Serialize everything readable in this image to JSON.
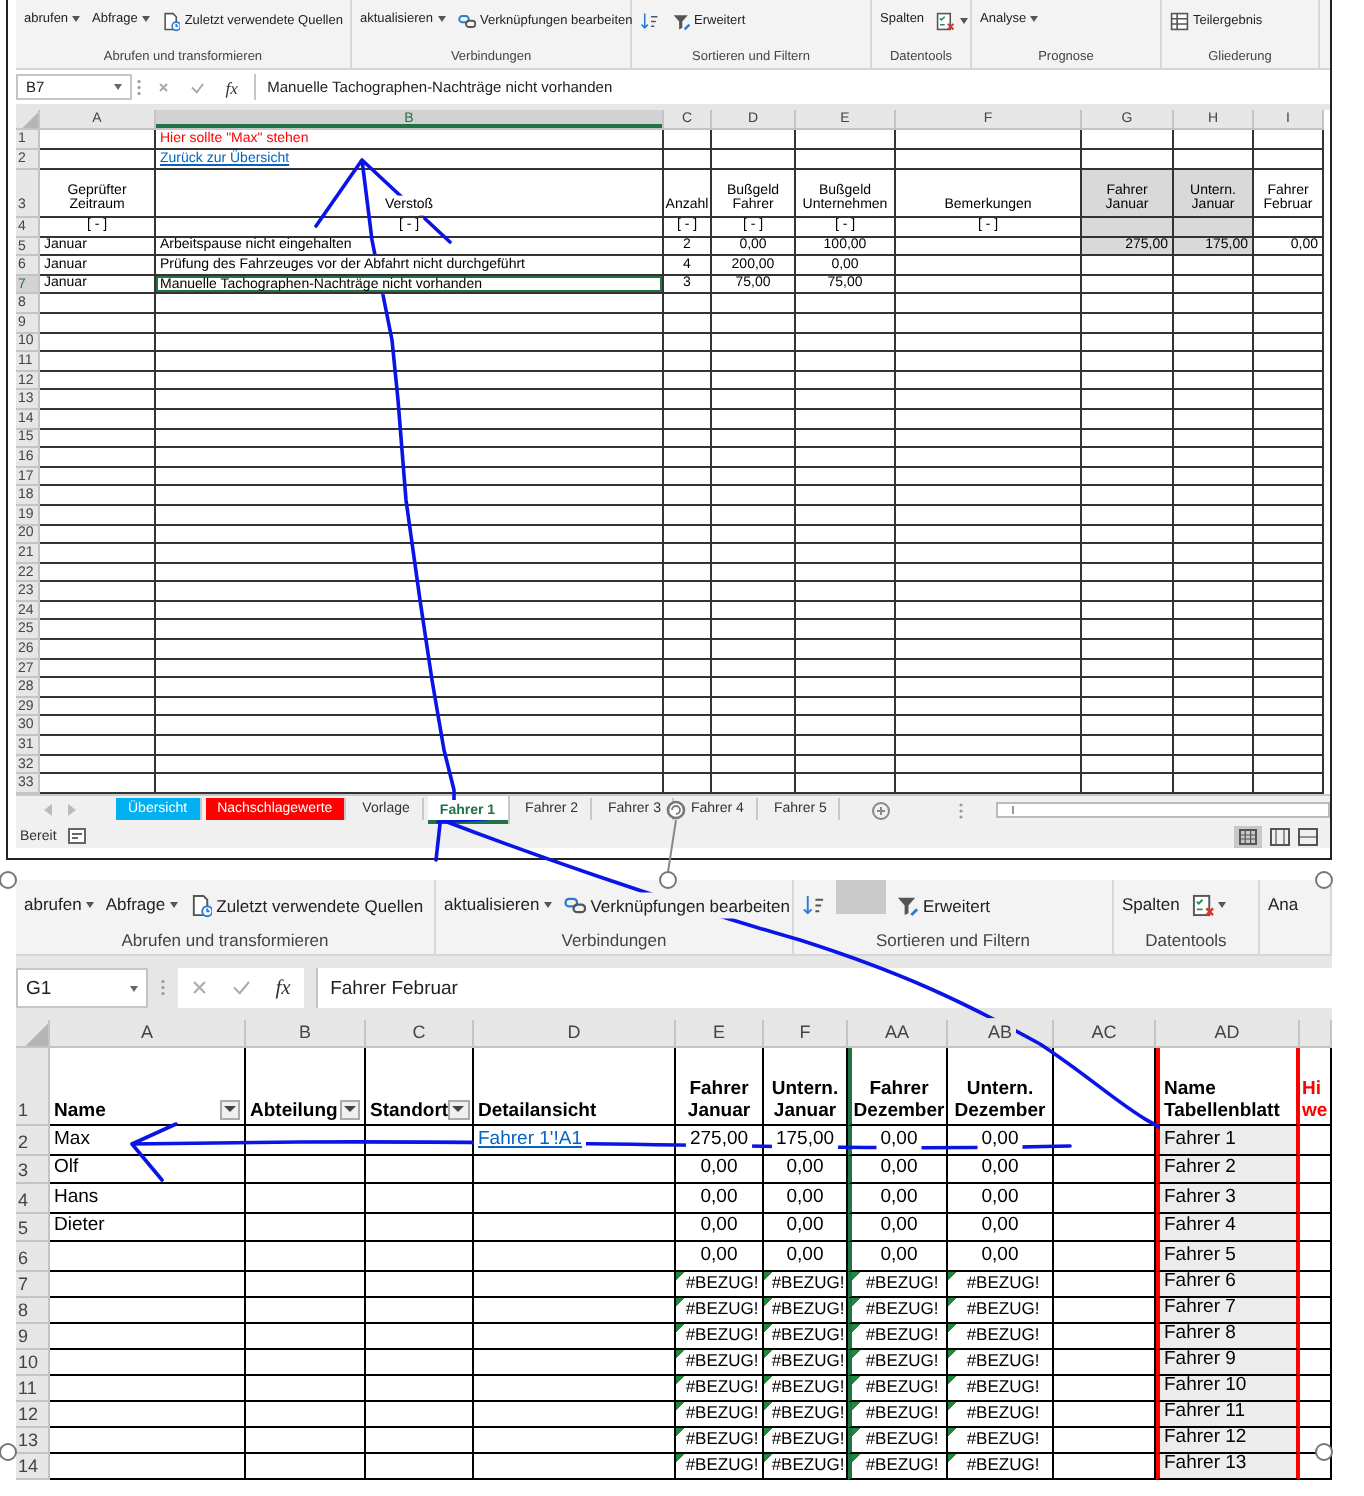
{
  "top_window": {
    "ribbon": {
      "groups": [
        {
          "label": "Abrufen und transformieren",
          "commands": [
            {
              "label": "abrufen",
              "dropdown": true,
              "pressed": false
            },
            {
              "label": "Abfrage",
              "dropdown": true,
              "pressed": false
            },
            {
              "label": "Zuletzt verwendete Quellen",
              "dropdown": false,
              "pressed": false
            }
          ]
        },
        {
          "label": "Verbindungen",
          "commands": [
            {
              "label": "aktualisieren",
              "dropdown": true,
              "pressed": false
            },
            {
              "label": "Verknüpfungen bearbeiten",
              "dropdown": false,
              "pressed": false
            }
          ]
        },
        {
          "label": "Sortieren und Filtern",
          "commands": [
            {
              "dropdown": false,
              "pressed": false
            },
            {
              "label": "Erweitert",
              "dropdown": false,
              "pressed": false
            }
          ]
        },
        {
          "label": "Datentools",
          "commands": [
            {
              "label": "Spalten",
              "dropdown": false,
              "pressed": false
            },
            {
              "dropdown": true,
              "pressed": false
            }
          ]
        },
        {
          "label": "Prognose",
          "commands": [
            {
              "label": "Analyse",
              "dropdown": true,
              "pressed": false
            }
          ]
        },
        {
          "label": "Gliederung",
          "commands": [
            {
              "label": "Teilergebnis",
              "dropdown": false,
              "pressed": false
            }
          ]
        }
      ]
    },
    "formula_bar": {
      "name_box": "B7",
      "function_label": "fx",
      "formula": "Manuelle Tachographen-Nachträge nicht vorhanden"
    },
    "grid": {
      "columns": [
        {
          "label": "A",
          "selected": false
        },
        {
          "label": "B",
          "selected": true
        },
        {
          "label": "C",
          "selected": false
        },
        {
          "label": "D",
          "selected": false
        },
        {
          "label": "E",
          "selected": false
        },
        {
          "label": "F",
          "selected": false
        },
        {
          "label": "G",
          "selected": false
        },
        {
          "label": "H",
          "selected": false
        },
        {
          "label": "I",
          "selected": false
        }
      ],
      "rows": [
        {
          "number": "1",
          "kind": "note",
          "selected": false,
          "cells": {
            "B": "Hier sollte \"Max\" stehen"
          }
        },
        {
          "number": "2",
          "kind": "link",
          "selected": false,
          "cells": {
            "B": "Zurück zur Übersicht"
          }
        },
        {
          "number": "3",
          "kind": "header",
          "selected": false,
          "shaded": true,
          "cells": {
            "A": "Geprüfter Zeitraum",
            "B": "Verstoß",
            "C": "Anzahl",
            "D": "Bußgeld Fahrer",
            "E": "Bußgeld Unternehmen",
            "F": "Bemerkungen",
            "G": "Fahrer Januar",
            "H": "Untern. Januar",
            "I": "Fahrer Februar"
          }
        },
        {
          "number": "4",
          "kind": "filter",
          "selected": false,
          "shaded": true,
          "cells": {
            "A": "[ - ]",
            "B": "[ - ]",
            "C": "[ - ]",
            "D": "[ - ]",
            "E": "[ - ]",
            "F": "[ - ]"
          }
        },
        {
          "number": "5",
          "kind": "data",
          "selected": false,
          "shaded": true,
          "cells": {
            "A": "Januar",
            "B": "Arbeitspause nicht eingehalten",
            "C": "2",
            "D": "0,00",
            "E": "100,00",
            "G": "275,00",
            "H": "175,00",
            "I": "0,00"
          }
        },
        {
          "number": "6",
          "kind": "data",
          "selected": false,
          "cells": {
            "A": "Januar",
            "B": "Prüfung des Fahrzeuges vor der Abfahrt nicht durchgeführt",
            "C": "4",
            "D": "200,00",
            "E": "0,00"
          }
        },
        {
          "number": "7",
          "kind": "data",
          "selected": true,
          "cells": {
            "A": "Januar",
            "B": "Manuelle Tachographen-Nachträge nicht vorhanden",
            "C": "3",
            "D": "75,00",
            "E": "75,00"
          }
        },
        {
          "number": "8",
          "kind": "data",
          "selected": false
        },
        {
          "number": "9",
          "kind": "data",
          "selected": false
        },
        {
          "number": "10",
          "kind": "data",
          "selected": false
        },
        {
          "number": "11",
          "kind": "data",
          "selected": false
        },
        {
          "number": "12",
          "kind": "data",
          "selected": false
        },
        {
          "number": "13",
          "kind": "data",
          "selected": false
        },
        {
          "number": "14",
          "kind": "data",
          "selected": false
        },
        {
          "number": "15",
          "kind": "data",
          "selected": false
        },
        {
          "number": "16",
          "kind": "data",
          "selected": false
        },
        {
          "number": "17",
          "kind": "data",
          "selected": false
        },
        {
          "number": "18",
          "kind": "data",
          "selected": false
        },
        {
          "number": "19",
          "kind": "data",
          "selected": false
        },
        {
          "number": "20",
          "kind": "data",
          "selected": false
        },
        {
          "number": "21",
          "kind": "data",
          "selected": false
        },
        {
          "number": "22",
          "kind": "data",
          "selected": false
        },
        {
          "number": "23",
          "kind": "data",
          "selected": false
        },
        {
          "number": "24",
          "kind": "data",
          "selected": false
        },
        {
          "number": "25",
          "kind": "data",
          "selected": false
        },
        {
          "number": "26",
          "kind": "data",
          "selected": false
        },
        {
          "number": "27",
          "kind": "data",
          "selected": false
        },
        {
          "number": "28",
          "kind": "data",
          "selected": false
        },
        {
          "number": "29",
          "kind": "data",
          "selected": false
        },
        {
          "number": "30",
          "kind": "data",
          "selected": false
        },
        {
          "number": "31",
          "kind": "data",
          "selected": false
        },
        {
          "number": "32",
          "kind": "data",
          "selected": false
        },
        {
          "number": "33",
          "kind": "data",
          "selected": false
        }
      ]
    },
    "sheet_tabs": [
      {
        "label": "Übersicht",
        "color": "#00b0f0",
        "selected": false
      },
      {
        "label": "Nachschlagewerte",
        "color": "#ff0000",
        "selected": false
      },
      {
        "label": "Vorlage",
        "selected": false
      },
      {
        "label": "Fahrer 1",
        "selected": true
      },
      {
        "label": "Fahrer 2",
        "selected": false
      },
      {
        "label": "Fahrer 3",
        "selected": false
      },
      {
        "label": "Fahrer 4",
        "selected": false
      },
      {
        "label": "Fahrer 5",
        "selected": false
      }
    ],
    "status_bar": {
      "text": "Bereit"
    }
  },
  "bottom_window": {
    "ribbon": {
      "groups": [
        {
          "label": "Abrufen und transformieren",
          "commands": [
            {
              "label": "abrufen",
              "dropdown": true,
              "pressed": false
            },
            {
              "label": "Abfrage",
              "dropdown": true,
              "pressed": false
            },
            {
              "label": "Zuletzt verwendete Quellen",
              "dropdown": false,
              "pressed": false
            }
          ]
        },
        {
          "label": "Verbindungen",
          "commands": [
            {
              "label": "aktualisieren",
              "dropdown": true,
              "pressed": false
            },
            {
              "label": "Verknüpfungen bearbeiten",
              "dropdown": false,
              "pressed": false
            }
          ]
        },
        {
          "label": "Sortieren und Filtern",
          "commands": [
            {
              "dropdown": false,
              "pressed": false
            },
            {
              "dropdown": false,
              "pressed": true
            },
            {
              "label": "Erweitert",
              "dropdown": false,
              "pressed": false
            }
          ]
        },
        {
          "label": "Datentools",
          "commands": [
            {
              "label": "Spalten",
              "dropdown": false,
              "pressed": false
            },
            {
              "dropdown": true,
              "pressed": false
            }
          ]
        },
        {
          "commands": [
            {
              "label": "Ana",
              "dropdown": false,
              "pressed": false
            }
          ]
        }
      ]
    },
    "formula_bar": {
      "name_box": "G1",
      "function_label": "fx",
      "formula": "Fahrer Februar"
    },
    "grid": {
      "columns": [
        {
          "label": "A",
          "kind": "plain",
          "selected": false
        },
        {
          "label": "B",
          "kind": "plain",
          "selected": false
        },
        {
          "label": "C",
          "kind": "plain",
          "selected": false
        },
        {
          "label": "D",
          "kind": "link",
          "selected": false
        },
        {
          "label": "E",
          "kind": "plain",
          "selected": false
        },
        {
          "label": "F",
          "kind": "plain",
          "selected": false
        },
        {
          "label": "AA",
          "kind": "boundary",
          "selected": false
        },
        {
          "label": "AB",
          "kind": "plain",
          "selected": false
        },
        {
          "label": "AC",
          "kind": "plain",
          "selected": false
        },
        {
          "label": "AD",
          "kind": "sheet_names",
          "selected": false
        },
        {
          "kind": "note",
          "selected": false
        }
      ],
      "rows": [
        {
          "number": "1",
          "kind": "header",
          "selected": false,
          "filter_buttons": true,
          "cells": {
            "A": "Name",
            "B": "Abteilung",
            "C": "Standort",
            "D": "Detailansicht",
            "E": "Fahrer Januar",
            "F": "Untern. Januar",
            "AA": "Fahrer Dezember",
            "AB": "Untern. Dezember",
            "AD": "Name Tabellenblatt",
            "column_11": "Hi we"
          }
        },
        {
          "number": "2",
          "kind": "data",
          "selected": false,
          "cells": {
            "A": "Max",
            "D": "Fahrer 1'!A1",
            "E": "275,00",
            "F": "175,00",
            "AA": "0,00",
            "AB": "0,00",
            "AD": "Fahrer 1"
          }
        },
        {
          "number": "3",
          "kind": "data",
          "selected": false,
          "cells": {
            "A": "Olf",
            "E": "0,00",
            "F": "0,00",
            "AA": "0,00",
            "AB": "0,00",
            "AD": "Fahrer 2"
          }
        },
        {
          "number": "4",
          "kind": "data",
          "selected": false,
          "cells": {
            "A": "Hans",
            "E": "0,00",
            "F": "0,00",
            "AA": "0,00",
            "AB": "0,00",
            "AD": "Fahrer 3"
          }
        },
        {
          "number": "5",
          "kind": "data",
          "selected": false,
          "cells": {
            "A": "Dieter",
            "E": "0,00",
            "F": "0,00",
            "AA": "0,00",
            "AB": "0,00",
            "AD": "Fahrer 4"
          }
        },
        {
          "number": "6",
          "kind": "data",
          "selected": false,
          "cells": {
            "E": "0,00",
            "F": "0,00",
            "AA": "0,00",
            "AB": "0,00",
            "AD": "Fahrer 5"
          }
        },
        {
          "number": "7",
          "kind": "error",
          "selected": false,
          "cells": {
            "E": "#BEZUG!",
            "F": "#BEZUG!",
            "AA": "#BEZUG!",
            "AB": "#BEZUG!",
            "AD": "Fahrer 6"
          }
        },
        {
          "number": "8",
          "kind": "error",
          "selected": false,
          "cells": {
            "E": "#BEZUG!",
            "F": "#BEZUG!",
            "AA": "#BEZUG!",
            "AB": "#BEZUG!",
            "AD": "Fahrer 7"
          }
        },
        {
          "number": "9",
          "kind": "error",
          "selected": false,
          "cells": {
            "E": "#BEZUG!",
            "F": "#BEZUG!",
            "AA": "#BEZUG!",
            "AB": "#BEZUG!",
            "AD": "Fahrer 8"
          }
        },
        {
          "number": "10",
          "kind": "error",
          "selected": false,
          "cells": {
            "E": "#BEZUG!",
            "F": "#BEZUG!",
            "AA": "#BEZUG!",
            "AB": "#BEZUG!",
            "AD": "Fahrer 9"
          }
        },
        {
          "number": "11",
          "kind": "error",
          "selected": false,
          "cells": {
            "E": "#BEZUG!",
            "F": "#BEZUG!",
            "AA": "#BEZUG!",
            "AB": "#BEZUG!",
            "AD": "Fahrer 10"
          }
        },
        {
          "number": "12",
          "kind": "error",
          "selected": false,
          "cells": {
            "E": "#BEZUG!",
            "F": "#BEZUG!",
            "AA": "#BEZUG!",
            "AB": "#BEZUG!",
            "AD": "Fahrer 11"
          }
        },
        {
          "number": "13",
          "kind": "error",
          "selected": false,
          "cells": {
            "E": "#BEZUG!",
            "F": "#BEZUG!",
            "AA": "#BEZUG!",
            "AB": "#BEZUG!",
            "AD": "Fahrer 12"
          }
        },
        {
          "number": "14",
          "kind": "error",
          "selected": false,
          "cells": {
            "E": "#BEZUG!",
            "F": "#BEZUG!",
            "AA": "#BEZUG!",
            "AB": "#BEZUG!",
            "AD": "Fahrer 13"
          }
        }
      ]
    }
  }
}
